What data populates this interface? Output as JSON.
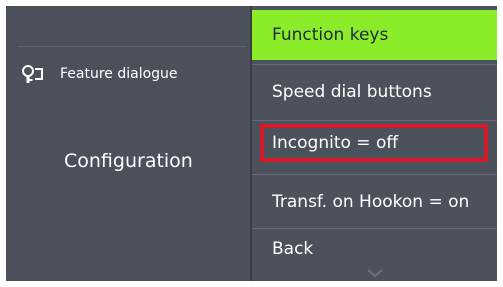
{
  "left_panel": {
    "feature_label": "Feature dialogue",
    "feature_icon": "key-lock-icon",
    "context_title": "Configuration"
  },
  "menu": {
    "items": [
      {
        "label": "Function keys",
        "selected": true
      },
      {
        "label": "Speed dial buttons",
        "selected": false
      },
      {
        "label": "Incognito = off",
        "selected": false,
        "highlighted": true
      },
      {
        "label": "Transf. on Hookon = on",
        "selected": false
      },
      {
        "label": "Back",
        "selected": false
      }
    ],
    "scroll_indicator": "chevron-down-icon"
  },
  "colors": {
    "background": "#4a4f59",
    "selected_item": "#8bed2a",
    "highlight_border": "#d11a2a",
    "text": "#ffffff"
  }
}
